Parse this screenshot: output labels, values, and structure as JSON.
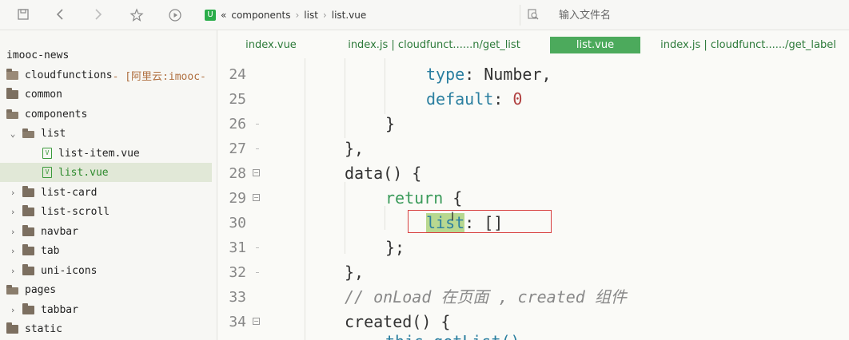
{
  "toolbar": {
    "icons": [
      "save-icon",
      "back-icon",
      "forward-icon",
      "star-icon",
      "play-icon"
    ],
    "breadcrumb": {
      "prefix": "«",
      "parts": [
        "components",
        "list",
        "list.vue"
      ],
      "separator": "›"
    },
    "search_placeholder": "输入文件名"
  },
  "sidebar": {
    "project": "imooc-news",
    "rows": [
      {
        "label": "cloudfunctions",
        "extra": " - [阿里云:imooc-",
        "kind": "folder"
      },
      {
        "label": "common",
        "kind": "folder"
      },
      {
        "label": "components",
        "kind": "folder-open"
      },
      {
        "label": "list",
        "kind": "folder-open",
        "chev": "⌄"
      },
      {
        "label": "list-item.vue",
        "kind": "vue"
      },
      {
        "label": "list.vue",
        "kind": "vue",
        "selected": true
      },
      {
        "label": "list-card",
        "kind": "folder",
        "chev": "›"
      },
      {
        "label": "list-scroll",
        "kind": "folder",
        "chev": "›"
      },
      {
        "label": "navbar",
        "kind": "folder",
        "chev": "›"
      },
      {
        "label": "tab",
        "kind": "folder",
        "chev": "›"
      },
      {
        "label": "uni-icons",
        "kind": "folder",
        "chev": "›"
      },
      {
        "label": "pages",
        "kind": "folder-open"
      },
      {
        "label": "tabbar",
        "kind": "folder",
        "chev": "›"
      },
      {
        "label": "static",
        "kind": "folder"
      }
    ]
  },
  "tabs": [
    {
      "label": "index.vue"
    },
    {
      "label": "index.js | cloudfunct......n/get_list"
    },
    {
      "label": "list.vue",
      "active": true
    },
    {
      "label": "index.js | cloudfunct....../get_label"
    }
  ],
  "editor": {
    "line_numbers": [
      "24",
      "25",
      "26",
      "27",
      "28",
      "29",
      "30",
      "31",
      "32",
      "33",
      "34"
    ],
    "folded": [
      "28",
      "29",
      "34"
    ],
    "lines": {
      "l24": {
        "a": "type",
        "b": ": ",
        "c": "Number",
        "d": ","
      },
      "l25": {
        "a": "default",
        "b": ": ",
        "c": "0"
      },
      "l26": "}",
      "l27": "},",
      "l28": "data() {",
      "l29": {
        "a": "return",
        "b": " {"
      },
      "l30": {
        "a": "list",
        "b": ": []"
      },
      "l31": "};",
      "l32": "},",
      "l33": "// onLoad 在页面 , created 组件",
      "l34": "created() {",
      "l35": "this.getList()"
    }
  },
  "colors": {
    "accent_green": "#4caa5c",
    "highlight_word": "#b8d890",
    "annotation_red": "#d84040"
  }
}
